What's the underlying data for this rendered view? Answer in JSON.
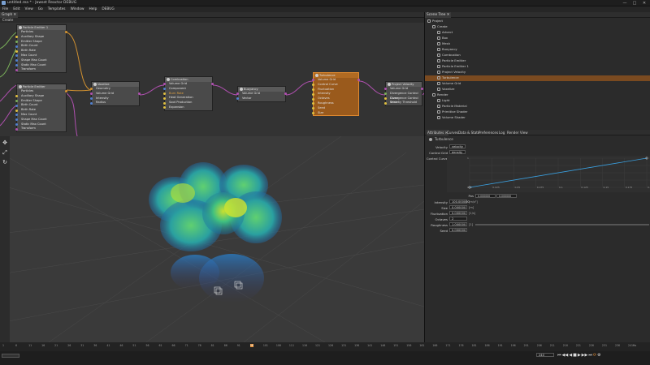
{
  "window": {
    "title": "untitled.rea * - Jawset Reactor DEBUG",
    "minimize": "—",
    "maximize": "□",
    "close": "✕"
  },
  "menu": [
    "File",
    "Edit",
    "View",
    "Go",
    "Templates",
    "Window",
    "Help",
    "DEBUG"
  ],
  "graph": {
    "tab": "Graph ✕",
    "subheader": "Create"
  },
  "nodes": {
    "emitter1": {
      "title": "Particle Emitter 1",
      "rows": [
        "Particles",
        "Auxiliary Shape",
        "Emitter Shape",
        "Birth Count",
        "Birth Rate",
        "Max Count",
        "Shape Max Count",
        "Static Max Count",
        "Transform"
      ]
    },
    "emitter2": {
      "title": "Particle Emitter",
      "rows": [
        "Particles",
        "Auxiliary Shape",
        "Emitter Shape",
        "Birth Count",
        "Birth Rate",
        "Max Count",
        "Shape Max Count",
        "Static Max Count",
        "Transform"
      ]
    },
    "voxelize": {
      "title": "Voxelize",
      "rows": [
        "Geometry",
        "Volume Grid",
        "Intensity",
        "Radius"
      ]
    },
    "combustion": {
      "title": "Combustion",
      "rows": [
        "Volume Grid",
        "Component",
        "Burn Rate",
        "Heat Generation",
        "Soot Production",
        "Expansion"
      ]
    },
    "buoyancy": {
      "title": "Buoyancy",
      "rows": [
        "Volume Grid",
        "Vector"
      ]
    },
    "turbulence": {
      "title": "Turbulence",
      "rows": [
        "Volume Grid",
        "Control Curve",
        "Fluctuation",
        "Intensity",
        "Octaves",
        "Roughness",
        "Seed",
        "Size"
      ]
    },
    "project": {
      "title": "Project Velocity",
      "rows": [
        "Volume Grid",
        "Divergence Control Curve",
        "Divergence Control Scale",
        "Velocity Threshold"
      ]
    }
  },
  "scene_tree": {
    "tab": "Scene Tree ✕",
    "items": [
      {
        "label": "Project",
        "indent": 0
      },
      {
        "label": "Create",
        "indent": 1
      },
      {
        "label": "Advect",
        "indent": 2
      },
      {
        "label": "Box",
        "indent": 2
      },
      {
        "label": "Mesh",
        "indent": 2
      },
      {
        "label": "Buoyancy",
        "indent": 2
      },
      {
        "label": "Combustion",
        "indent": 2
      },
      {
        "label": "Particle Emitter",
        "indent": 2
      },
      {
        "label": "Particle Emitter 1",
        "indent": 2
      },
      {
        "label": "Project Velocity",
        "indent": 2
      },
      {
        "label": "Turbulence",
        "indent": 2,
        "selected": true
      },
      {
        "label": "Volume Grid",
        "indent": 2
      },
      {
        "label": "Voxelize",
        "indent": 2
      },
      {
        "label": "Render",
        "indent": 1
      },
      {
        "label": "Light",
        "indent": 2
      },
      {
        "label": "Particle Material",
        "indent": 2
      },
      {
        "label": "Primitive Shader",
        "indent": 2
      },
      {
        "label": "Volume Shader",
        "indent": 2
      }
    ]
  },
  "attr_tabs": [
    "Attributes ✕",
    "Curves",
    "Data & Stats",
    "Preferences",
    "Log",
    "Render View"
  ],
  "attributes": {
    "node_name": "Turbulence",
    "velocity_label": "Velocity",
    "velocity_value": "velocity",
    "control_grid_label": "Control Grid",
    "control_grid_value": "density",
    "control_curve_label": "Control Curve",
    "curve_y_ticks": [
      "1",
      "0"
    ],
    "curve_x_ticks": [
      "0",
      "0.025",
      "0.05",
      "0.075",
      "0.1",
      "0.125",
      "0.15",
      "0.175",
      "0.2"
    ],
    "curve_points": [
      [
        0,
        0
      ],
      [
        0.2,
        1
      ]
    ],
    "pos_label": "Pos",
    "pos_value": "0.000000",
    "val_value": "0.000000",
    "intensity_label": "Intensity",
    "intensity_value": "100.000000",
    "intensity_unit": "[m/s²]",
    "size_label": "Size",
    "size_value": "0.000000",
    "size_unit": "[m]",
    "fluctuation_label": "Fluctuation",
    "fluctuation_value": "0.000000",
    "fluctuation_unit": "[1/s]",
    "octaves_label": "Octaves",
    "octaves_value": "2",
    "roughness_label": "Roughness",
    "roughness_value": "1.000000",
    "roughness_unit": "[1]",
    "seed_label": "Seed",
    "seed_value": "0.000000"
  },
  "timeline": {
    "ticks": [
      "1",
      "6",
      "11",
      "16",
      "21",
      "26",
      "31",
      "36",
      "41",
      "46",
      "51",
      "56",
      "61",
      "66",
      "71",
      "76",
      "81",
      "86",
      "91",
      "96",
      "101",
      "106",
      "111",
      "116",
      "121",
      "126",
      "131",
      "136",
      "141",
      "146",
      "151",
      "156",
      "161",
      "166",
      "171",
      "176",
      "181",
      "186",
      "191",
      "196",
      "201",
      "206",
      "211",
      "216",
      "221",
      "226",
      "231",
      "236",
      "241"
    ],
    "current_frame": "96",
    "frame_field": "240",
    "end_label": "fix"
  },
  "colors": {
    "accent": "#e08a30",
    "selected_node": "#9a5a1c",
    "curve": "#3aa0e0"
  }
}
